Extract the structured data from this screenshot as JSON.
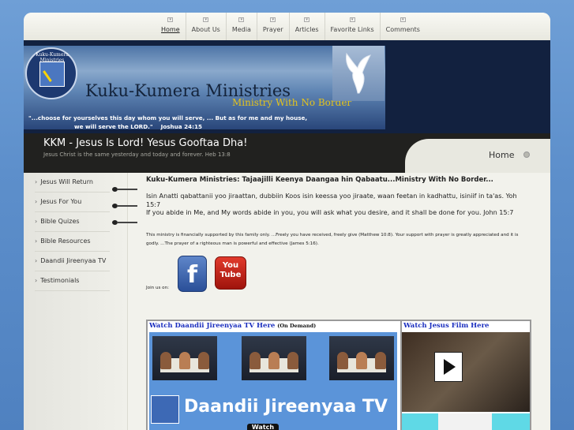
{
  "nav": {
    "items": [
      {
        "label": "Home",
        "active": true
      },
      {
        "label": "About Us"
      },
      {
        "label": "Media"
      },
      {
        "label": "Prayer"
      },
      {
        "label": "Articles"
      },
      {
        "label": "Favorite Links"
      },
      {
        "label": "Comments"
      }
    ]
  },
  "banner": {
    "seal_text": "Kuku-Kumera Ministries",
    "title": "Kuku-Kumera Ministries",
    "subtitle": "Ministry With No Border",
    "quote_line1": "\"...choose for yourselves this day whom you will serve, ... But as for me and my house,",
    "quote_line2": "we will serve the LORD.\"",
    "quote_ref": "Joshua 24:15"
  },
  "band": {
    "title": "KKM - Jesus Is Lord! Yesus Gooftaa Dha!",
    "subtitle": "Jesus Christ is the same yesterday and today and forever. Heb 13:8",
    "home_label": "Home"
  },
  "sidebar": {
    "items": [
      {
        "label": "Jesus Will Return"
      },
      {
        "label": "Jesus For You"
      },
      {
        "label": "Bible Quizes"
      },
      {
        "label": "Bible Resources"
      },
      {
        "label": "Daandii Jireenyaa TV"
      },
      {
        "label": "Testimonials"
      }
    ]
  },
  "main": {
    "title": "Kuku-Kumera Ministries: Tajaajilli Keenya Daangaa hin Qabaatu...Ministry With No Border...",
    "para1": "Isin Anatti qabattanii yoo jiraattan, dubbiin Koos isin keessa yoo jiraate, waan feetan in kadhattu, isiniif in ta'as. Yoh 15:7",
    "para2": "If you abide in Me, and My words abide in you, you will ask what you desire, and it shall be done for you.    John 15:7",
    "small": "This ministry is financially supported by this family only. ...Freely you have received, freely give (Matthew 10:8). Your support with prayer is greatly appreciated and it is godly. ...The prayer of a righteous man is powerful and effective (James 5:16).",
    "join": "Join us on:",
    "facebook_glyph": "f",
    "youtube_you": "You",
    "youtube_tube": "Tube"
  },
  "video": {
    "left_heading": "Watch Daandii Jireenyaa TV Here",
    "left_heading_note": "(On Demand)",
    "left_brand": "Daandii Jireenyaa TV",
    "left_watch": "Watch",
    "right_heading": "Watch Jesus Film Here"
  }
}
